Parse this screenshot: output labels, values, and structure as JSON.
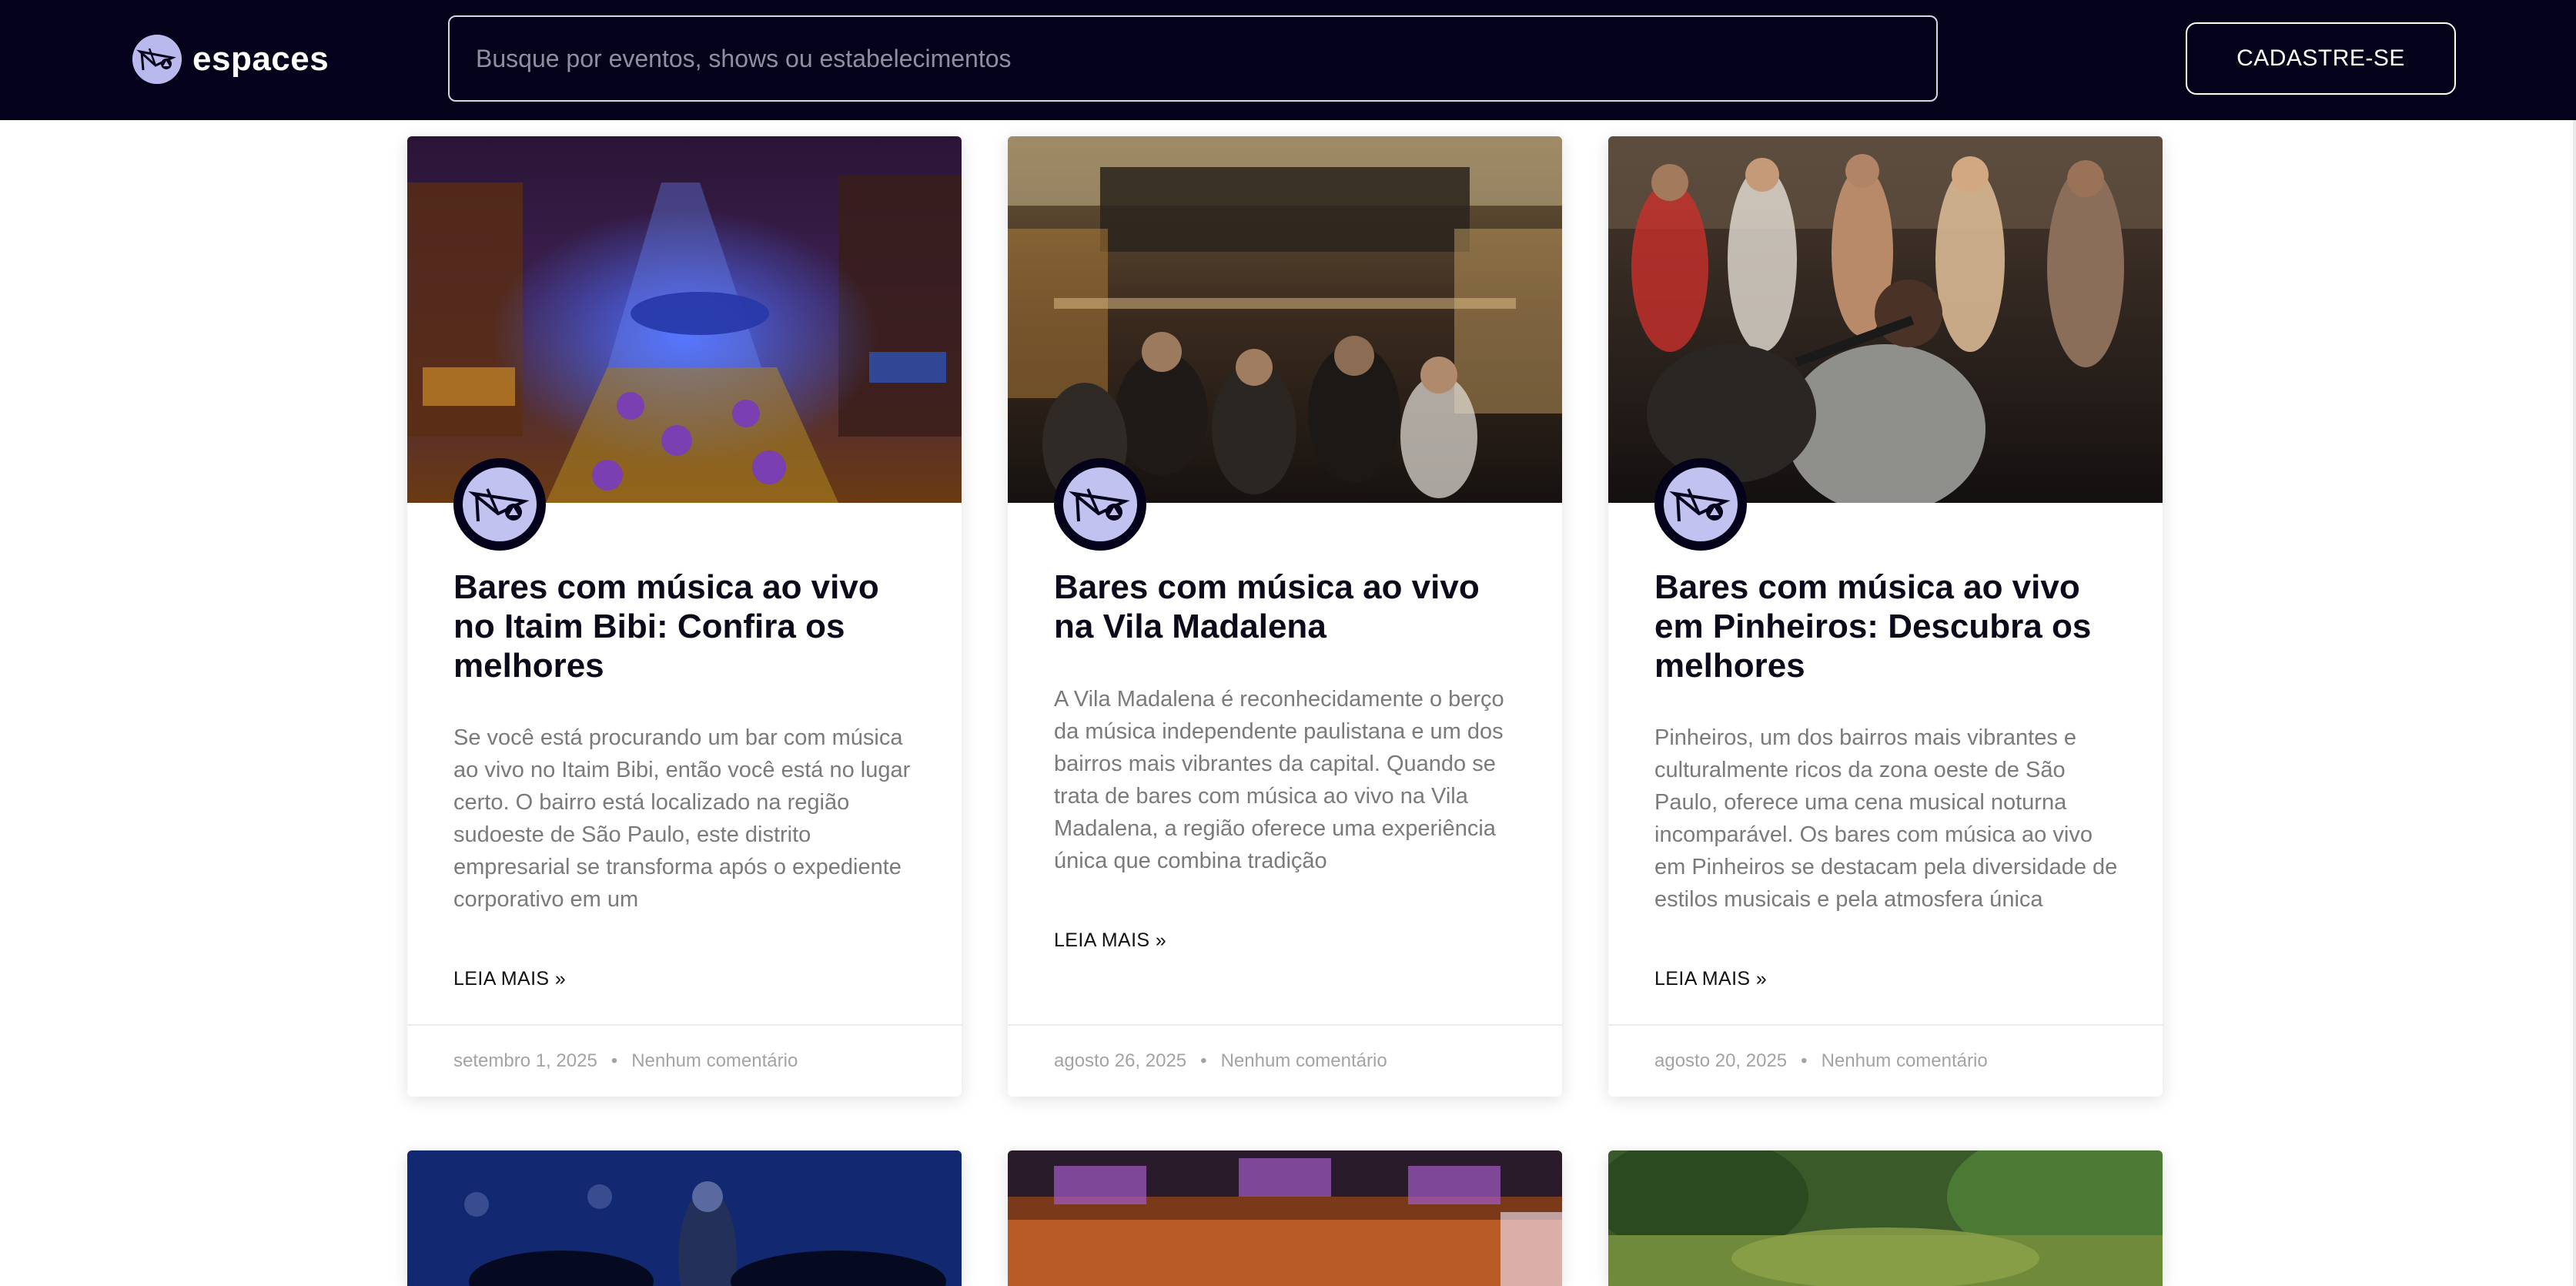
{
  "header": {
    "logo_text": "espaces",
    "search_placeholder": "Busque por eventos, shows ou estabelecimentos",
    "signup_label": "CADASTRE-SE"
  },
  "posts": [
    {
      "title": "Bares com música ao vivo no Itaim Bibi: Confira os melhores",
      "excerpt": "Se você está procurando um bar com música ao vivo no Itaim Bibi, então você está no lugar certo. O bairro está localizado na região sudoeste de São Paulo, este distrito empresarial se transforma após o expediente corporativo em um",
      "read_more": "LEIA MAIS »",
      "date": "setembro 1, 2025",
      "comments": "Nenhum comentário"
    },
    {
      "title": "Bares com música ao vivo na Vila Madalena",
      "excerpt": "A Vila Madalena é reconhecidamente o berço da música independente paulistana e um dos bairros mais vibrantes da capital. Quando se trata de bares com música ao vivo na Vila Madalena, a região oferece uma experiência única que combina tradição",
      "read_more": "LEIA MAIS »",
      "date": "agosto 26, 2025",
      "comments": "Nenhum comentário"
    },
    {
      "title": "Bares com música ao vivo em Pinheiros: Descubra os melhores",
      "excerpt": "Pinheiros, um dos bairros mais vibrantes e culturalmente ricos da zona oeste de São Paulo, oferece uma cena musical noturna incomparável. Os bares com música ao vivo em Pinheiros se destacam pela diversidade de estilos musicais e pela atmosfera única",
      "read_more": "LEIA MAIS »",
      "date": "agosto 20, 2025",
      "comments": "Nenhum comentário"
    }
  ],
  "footer_separator": "•"
}
